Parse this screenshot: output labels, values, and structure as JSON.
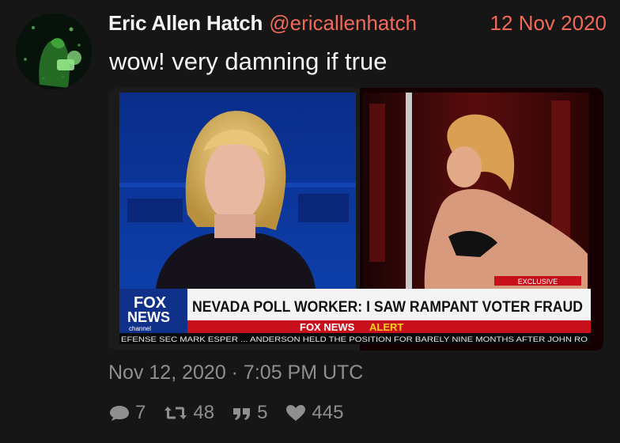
{
  "tweet": {
    "author_name": "Eric Allen Hatch",
    "handle": "@ericallenhatch",
    "date_short": "12 Nov 2020",
    "text": "wow! very damning if true",
    "timestamp": "Nov 12, 2020 · 7:05 PM UTC"
  },
  "media": {
    "chyron_headline": "NEVADA POLL WORKER: I SAW RAMPANT VOTER FRAUD",
    "exclusive_label": "EXCLUSIVE",
    "network_logo_top": "FOX",
    "network_logo_bottom": "NEWS",
    "network_logo_sub": "channel",
    "alert_prefix": "FOX NEWS",
    "alert_word": "ALERT",
    "ticker_text": "EFENSE SEC MARK ESPER ... ANDERSON HELD THE POSITION FOR BARELY NINE MONTHS AFTER JOHN RO"
  },
  "stats": {
    "replies": "7",
    "retweets": "48",
    "quotes": "5",
    "likes": "445"
  },
  "icons": [
    "avatar",
    "reply-icon",
    "retweet-icon",
    "quote-icon",
    "heart-icon"
  ],
  "colors": {
    "accent": "#f26a57",
    "muted": "#8f8f8f",
    "background": "#161616",
    "fox_blue": "#10318a",
    "alert_red": "#c8101c",
    "alert_yellow": "#ffd21a"
  }
}
